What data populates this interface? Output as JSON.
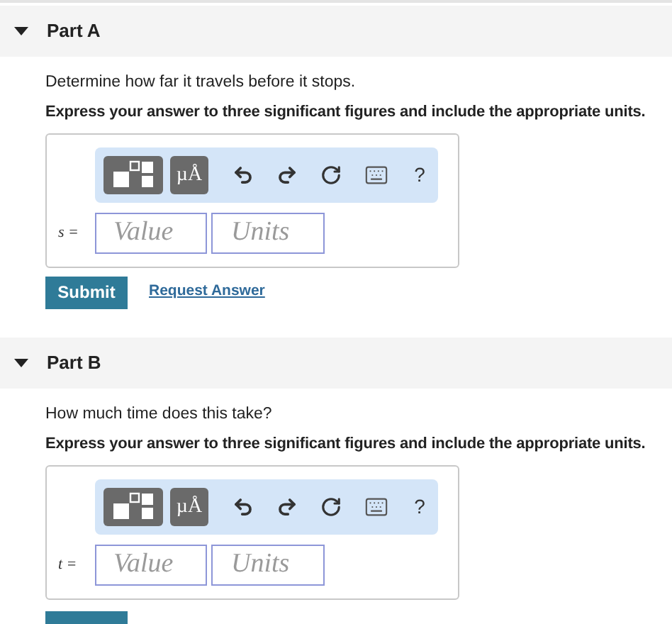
{
  "parts": [
    {
      "title": "Part A",
      "expanded": true,
      "question": "Determine how far it travels before it stops.",
      "instruction": "Express your answer to three significant figures and include the appropriate units.",
      "toolbar": {
        "units_label": "µÅ",
        "help_label": "?"
      },
      "variable": "s =",
      "value_placeholder": "Value",
      "units_placeholder": "Units",
      "actions": {
        "submit": "Submit",
        "request": "Request Answer"
      }
    },
    {
      "title": "Part B",
      "expanded": true,
      "question": "How much time does this take?",
      "instruction": "Express your answer to three significant figures and include the appropriate units.",
      "toolbar": {
        "units_label": "µÅ",
        "help_label": "?"
      },
      "variable": "t =",
      "value_placeholder": "Value",
      "units_placeholder": "Units",
      "actions_cut": true
    }
  ]
}
